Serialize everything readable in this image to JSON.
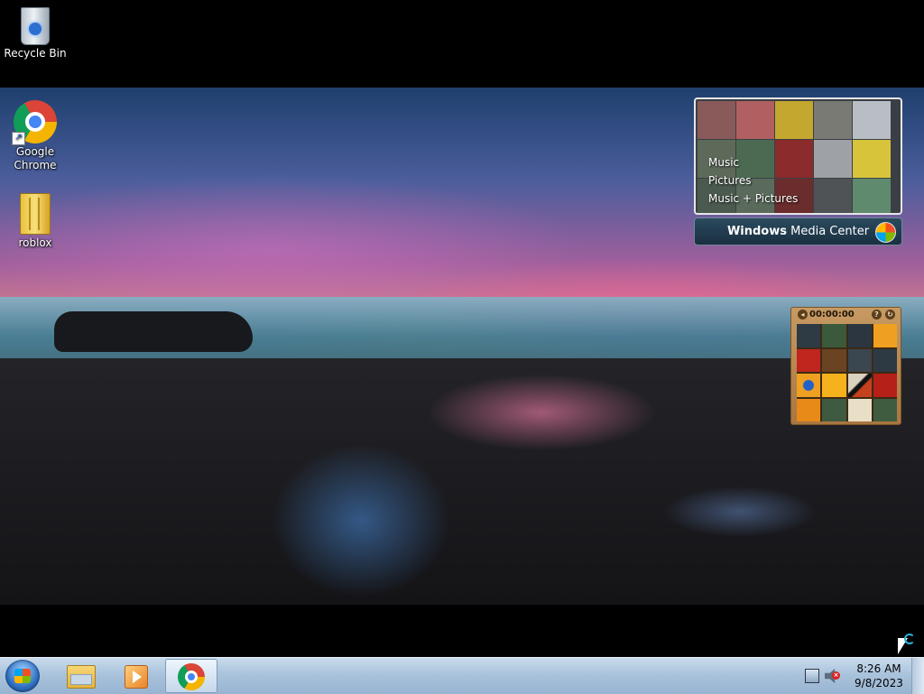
{
  "desktop": {
    "icons": [
      {
        "label": "Recycle Bin",
        "icon": "recycle-bin-icon"
      },
      {
        "label": "Google Chrome",
        "icon": "chrome-icon"
      },
      {
        "label": "roblox",
        "icon": "folder-icon"
      }
    ]
  },
  "media_center_gadget": {
    "menu": [
      "Music",
      "Pictures",
      "Music + Pictures"
    ],
    "brand_bold": "Windows",
    "brand_rest": " Media Center"
  },
  "puzzle_gadget": {
    "timer": "00:00:00",
    "help_symbol": "?",
    "shuffle_symbol": "↻",
    "back_symbol": "◂"
  },
  "taskbar": {
    "start_icon": "windows-start-orb",
    "pinned": [
      {
        "name": "windows-explorer",
        "icon": "folder-icon",
        "active": false
      },
      {
        "name": "windows-media-player",
        "icon": "media-player-icon",
        "active": false
      },
      {
        "name": "google-chrome",
        "icon": "chrome-icon",
        "active": true
      }
    ],
    "tray": {
      "time": "8:26 AM",
      "date": "9/8/2023",
      "network_icon": "network-icon",
      "volume_icon": "speaker-muted-icon"
    }
  },
  "colors": {
    "taskbar_top": "#c9dbec",
    "taskbar_bottom": "#98b4d1",
    "desktop_bg": "#000000"
  }
}
